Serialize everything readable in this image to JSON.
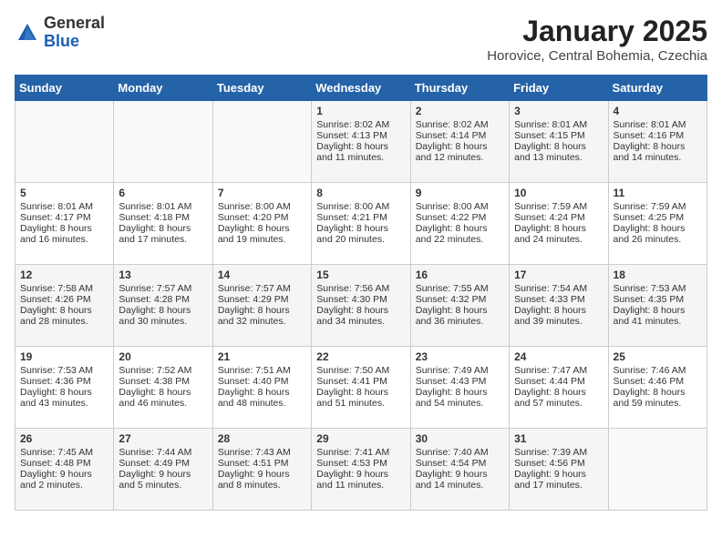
{
  "header": {
    "logo_general": "General",
    "logo_blue": "Blue",
    "month": "January 2025",
    "location": "Horovice, Central Bohemia, Czechia"
  },
  "weekdays": [
    "Sunday",
    "Monday",
    "Tuesday",
    "Wednesday",
    "Thursday",
    "Friday",
    "Saturday"
  ],
  "weeks": [
    [
      {
        "day": "",
        "text": ""
      },
      {
        "day": "",
        "text": ""
      },
      {
        "day": "",
        "text": ""
      },
      {
        "day": "1",
        "text": "Sunrise: 8:02 AM\nSunset: 4:13 PM\nDaylight: 8 hours and 11 minutes."
      },
      {
        "day": "2",
        "text": "Sunrise: 8:02 AM\nSunset: 4:14 PM\nDaylight: 8 hours and 12 minutes."
      },
      {
        "day": "3",
        "text": "Sunrise: 8:01 AM\nSunset: 4:15 PM\nDaylight: 8 hours and 13 minutes."
      },
      {
        "day": "4",
        "text": "Sunrise: 8:01 AM\nSunset: 4:16 PM\nDaylight: 8 hours and 14 minutes."
      }
    ],
    [
      {
        "day": "5",
        "text": "Sunrise: 8:01 AM\nSunset: 4:17 PM\nDaylight: 8 hours and 16 minutes."
      },
      {
        "day": "6",
        "text": "Sunrise: 8:01 AM\nSunset: 4:18 PM\nDaylight: 8 hours and 17 minutes."
      },
      {
        "day": "7",
        "text": "Sunrise: 8:00 AM\nSunset: 4:20 PM\nDaylight: 8 hours and 19 minutes."
      },
      {
        "day": "8",
        "text": "Sunrise: 8:00 AM\nSunset: 4:21 PM\nDaylight: 8 hours and 20 minutes."
      },
      {
        "day": "9",
        "text": "Sunrise: 8:00 AM\nSunset: 4:22 PM\nDaylight: 8 hours and 22 minutes."
      },
      {
        "day": "10",
        "text": "Sunrise: 7:59 AM\nSunset: 4:24 PM\nDaylight: 8 hours and 24 minutes."
      },
      {
        "day": "11",
        "text": "Sunrise: 7:59 AM\nSunset: 4:25 PM\nDaylight: 8 hours and 26 minutes."
      }
    ],
    [
      {
        "day": "12",
        "text": "Sunrise: 7:58 AM\nSunset: 4:26 PM\nDaylight: 8 hours and 28 minutes."
      },
      {
        "day": "13",
        "text": "Sunrise: 7:57 AM\nSunset: 4:28 PM\nDaylight: 8 hours and 30 minutes."
      },
      {
        "day": "14",
        "text": "Sunrise: 7:57 AM\nSunset: 4:29 PM\nDaylight: 8 hours and 32 minutes."
      },
      {
        "day": "15",
        "text": "Sunrise: 7:56 AM\nSunset: 4:30 PM\nDaylight: 8 hours and 34 minutes."
      },
      {
        "day": "16",
        "text": "Sunrise: 7:55 AM\nSunset: 4:32 PM\nDaylight: 8 hours and 36 minutes."
      },
      {
        "day": "17",
        "text": "Sunrise: 7:54 AM\nSunset: 4:33 PM\nDaylight: 8 hours and 39 minutes."
      },
      {
        "day": "18",
        "text": "Sunrise: 7:53 AM\nSunset: 4:35 PM\nDaylight: 8 hours and 41 minutes."
      }
    ],
    [
      {
        "day": "19",
        "text": "Sunrise: 7:53 AM\nSunset: 4:36 PM\nDaylight: 8 hours and 43 minutes."
      },
      {
        "day": "20",
        "text": "Sunrise: 7:52 AM\nSunset: 4:38 PM\nDaylight: 8 hours and 46 minutes."
      },
      {
        "day": "21",
        "text": "Sunrise: 7:51 AM\nSunset: 4:40 PM\nDaylight: 8 hours and 48 minutes."
      },
      {
        "day": "22",
        "text": "Sunrise: 7:50 AM\nSunset: 4:41 PM\nDaylight: 8 hours and 51 minutes."
      },
      {
        "day": "23",
        "text": "Sunrise: 7:49 AM\nSunset: 4:43 PM\nDaylight: 8 hours and 54 minutes."
      },
      {
        "day": "24",
        "text": "Sunrise: 7:47 AM\nSunset: 4:44 PM\nDaylight: 8 hours and 57 minutes."
      },
      {
        "day": "25",
        "text": "Sunrise: 7:46 AM\nSunset: 4:46 PM\nDaylight: 8 hours and 59 minutes."
      }
    ],
    [
      {
        "day": "26",
        "text": "Sunrise: 7:45 AM\nSunset: 4:48 PM\nDaylight: 9 hours and 2 minutes."
      },
      {
        "day": "27",
        "text": "Sunrise: 7:44 AM\nSunset: 4:49 PM\nDaylight: 9 hours and 5 minutes."
      },
      {
        "day": "28",
        "text": "Sunrise: 7:43 AM\nSunset: 4:51 PM\nDaylight: 9 hours and 8 minutes."
      },
      {
        "day": "29",
        "text": "Sunrise: 7:41 AM\nSunset: 4:53 PM\nDaylight: 9 hours and 11 minutes."
      },
      {
        "day": "30",
        "text": "Sunrise: 7:40 AM\nSunset: 4:54 PM\nDaylight: 9 hours and 14 minutes."
      },
      {
        "day": "31",
        "text": "Sunrise: 7:39 AM\nSunset: 4:56 PM\nDaylight: 9 hours and 17 minutes."
      },
      {
        "day": "",
        "text": ""
      }
    ]
  ]
}
